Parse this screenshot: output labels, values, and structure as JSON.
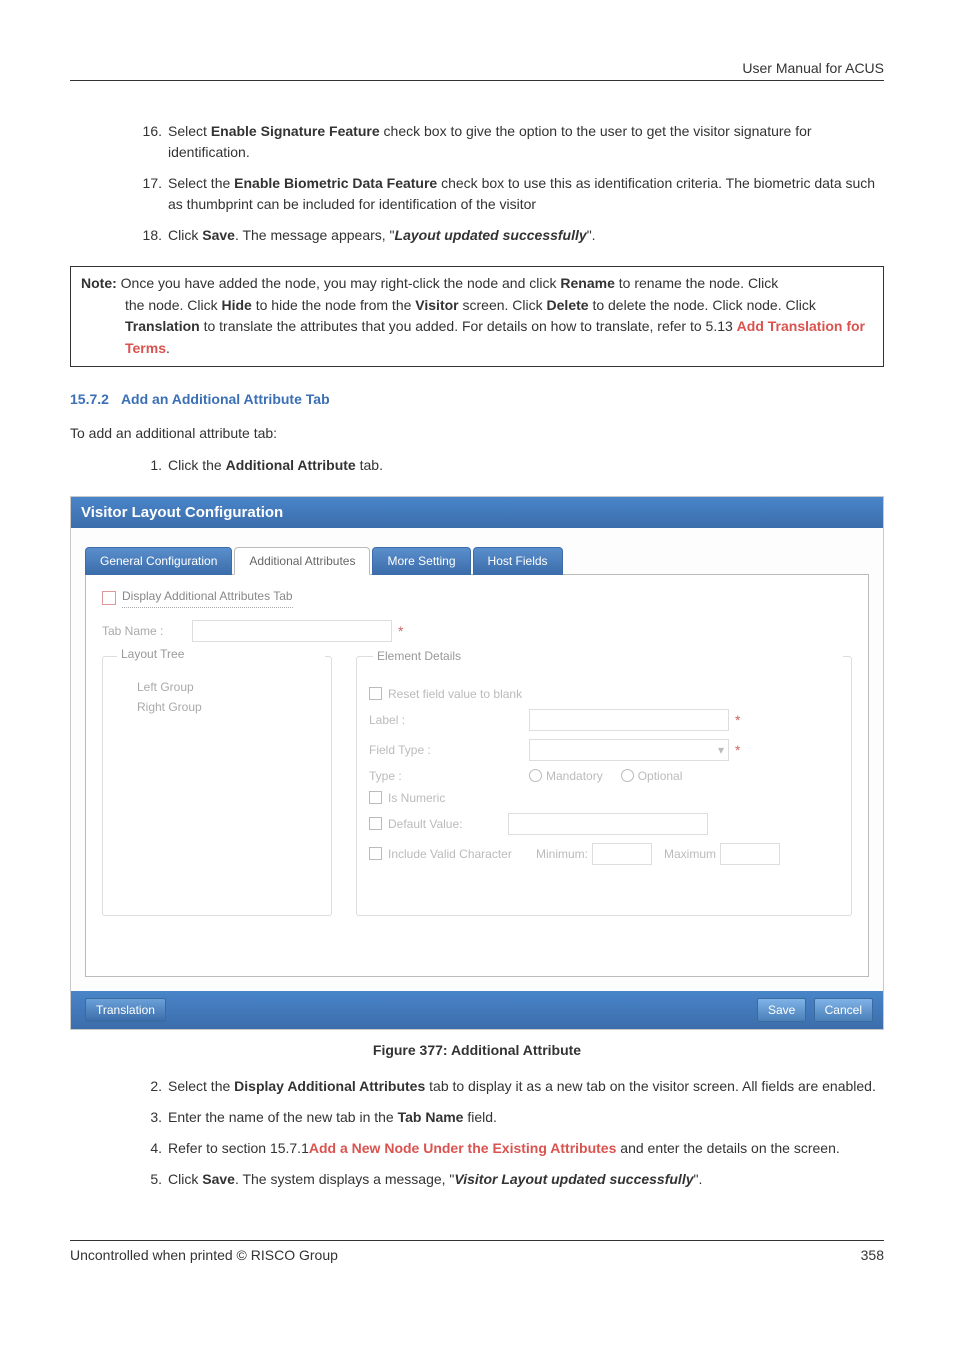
{
  "header": {
    "title": "User Manual for ACUS"
  },
  "list1": {
    "i16": {
      "num": "16.",
      "pre": "Select ",
      "b": "Enable Signature Feature",
      "post": " check box to give the option to the user to get the visitor signature for identification."
    },
    "i17": {
      "num": "17.",
      "pre": "Select the ",
      "b": "Enable Biometric Data Feature",
      "post": " check box to use this as identification criteria. The biometric data such as thumbprint can be included for identification of the visitor"
    },
    "i18": {
      "num": "18.",
      "pre": "Click ",
      "b": "Save",
      "mid": ". The message appears, \"",
      "bi": "Layout updated successfully",
      "post": "\"."
    }
  },
  "note": {
    "label": "Note:",
    "t1": " Once you have added the node, you may right-click the node and click ",
    "b1": "Rename",
    "t2": " to rename the node. Click ",
    "b2": "Hide",
    "t3": " to hide the node from the ",
    "b3": "Visitor",
    "t4": " screen. Click ",
    "b4": "Delete",
    "t5": " to delete the node. Click ",
    "b5": "Translation",
    "t6": " to translate the attributes that you added. For details on how to translate, refer to 5.13 ",
    "link": "Add Translation for Terms",
    "t7": "."
  },
  "section": {
    "num": "15.7.2",
    "title": "Add an Additional Attribute Tab"
  },
  "intro": "To add an additional attribute tab:",
  "step1": {
    "num": "1.",
    "pre": "Click the ",
    "b": "Additional Attribute",
    "post": " tab."
  },
  "figure": {
    "title": "Visitor Layout Configuration",
    "tabs": {
      "t1": "General Configuration",
      "t2": "Additional Attributes",
      "t3": "More Setting",
      "t4": "Host Fields"
    },
    "chk_display": "Display Additional Attributes Tab",
    "tab_name_label": "Tab Name :",
    "tree": {
      "legend": "Layout Tree",
      "left": "Left Group",
      "right": "Right Group"
    },
    "details": {
      "legend": "Element Details",
      "reset": "Reset field value to blank",
      "label": "Label :",
      "fieldtype": "Field Type :",
      "type": "Type :",
      "mandatory": "Mandatory",
      "optional": "Optional",
      "isnum": "Is Numeric",
      "defval": "Default Value:",
      "incvalid": "Include Valid Character",
      "min": "Minimum:",
      "max": "Maximum"
    },
    "buttons": {
      "trans": "Translation",
      "save": "Save",
      "cancel": "Cancel"
    },
    "caption": "Figure 377: Additional Attribute"
  },
  "list2": {
    "i2": {
      "num": "2.",
      "pre": "Select the ",
      "b": "Display Additional Attributes",
      "post": " tab to display it as a new tab on the visitor screen. All fields are enabled."
    },
    "i3": {
      "num": "3.",
      "pre": "Enter the name of the new tab in the ",
      "b": "Tab Name",
      "post": " field."
    },
    "i4": {
      "num": "4.",
      "pre": "Refer to section 15.7.1",
      "link": "Add a New Node Under the Existing Attributes",
      "post": " and enter the details on the screen."
    },
    "i5": {
      "num": "5.",
      "pre": "Click ",
      "b": "Save",
      "mid": ". The system displays a message, \"",
      "bi": "Visitor Layout updated successfully",
      "post": "\"."
    }
  },
  "footer": {
    "left": "Uncontrolled when printed © RISCO Group",
    "right": "358"
  }
}
